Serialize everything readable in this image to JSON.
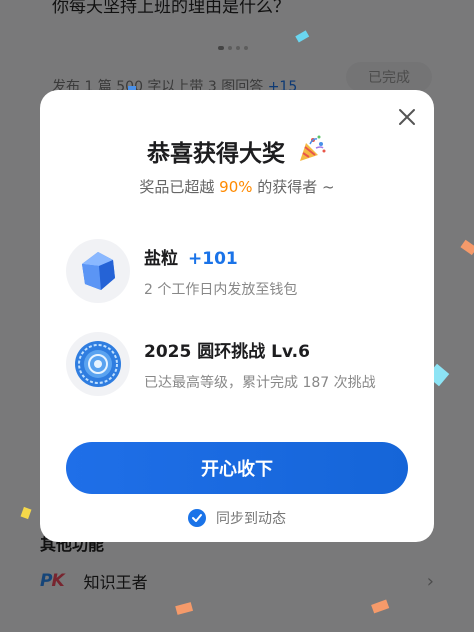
{
  "background": {
    "question": "你每天坚持上班的理由是什么？",
    "task_text": "发布 1 篇 500 字以上带 3 图回答",
    "task_bonus": "+15",
    "done_label": "已完成",
    "section_title": "其他功能",
    "row": {
      "icon": "pk-icon",
      "label": "知识王者"
    }
  },
  "dialog": {
    "title": "恭喜获得大奖",
    "subtitle_prefix": "奖品已超越 ",
    "subtitle_percent": "90%",
    "subtitle_suffix": " 的获得者 ~",
    "prizes": [
      {
        "icon": "salt-crystal-icon",
        "name": "盐粒",
        "amount": "+101",
        "desc": "2 个工作日内发放至钱包"
      },
      {
        "icon": "ring-badge-icon",
        "name": "2025 圆环挑战 Lv.6",
        "desc": "已达最高等级，累计完成 187 次挑战"
      }
    ],
    "accept_label": "开心收下",
    "sync_label": "同步到动态",
    "sync_checked": true
  },
  "colors": {
    "accent": "#1a73e8",
    "highlight": "#ff8a00",
    "overlay": "rgba(0,0,0,0.5)"
  }
}
